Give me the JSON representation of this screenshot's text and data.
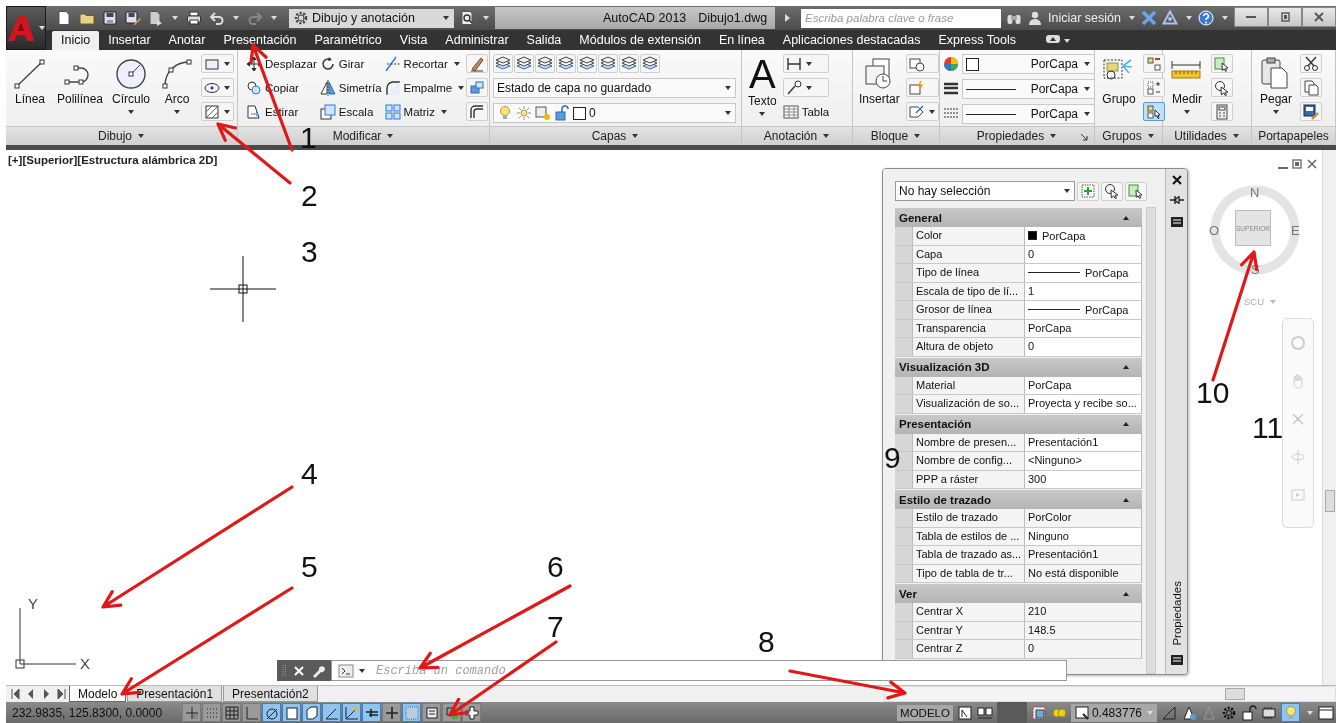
{
  "title_bar": {
    "workspace": "Dibujo y anotación",
    "app_title": "AutoCAD 2013",
    "file_name": "Dibujo1.dwg",
    "search_placeholder": "Escriba palabra clave o frase",
    "sign_in": "Iniciar sesión"
  },
  "ribbon_tabs": [
    {
      "label": "Inicio",
      "selected": true
    },
    {
      "label": "Insertar",
      "selected": false
    },
    {
      "label": "Anotar",
      "selected": false
    },
    {
      "label": "Presentación",
      "selected": false
    },
    {
      "label": "Paramétrico",
      "selected": false
    },
    {
      "label": "Vista",
      "selected": false
    },
    {
      "label": "Administrar",
      "selected": false
    },
    {
      "label": "Salida",
      "selected": false
    },
    {
      "label": "Módulos de extensión",
      "selected": false
    },
    {
      "label": "En línea",
      "selected": false
    },
    {
      "label": "Aplicaciones destacadas",
      "selected": false
    },
    {
      "label": "Express Tools",
      "selected": false
    }
  ],
  "ribbon_panels": [
    {
      "kind": "draw",
      "title": "Dibujo",
      "menu": true,
      "tools": [
        {
          "label": "Línea",
          "menu": false
        },
        {
          "label": "Polilínea",
          "menu": false
        },
        {
          "label": "Círculo",
          "menu": true
        },
        {
          "label": "Arco",
          "menu": true
        }
      ]
    },
    {
      "kind": "modify",
      "title": "Modificar",
      "menu": true,
      "tools": [
        {
          "label": "Desplazar",
          "menu": false
        },
        {
          "label": "Girar",
          "menu": false
        },
        {
          "label": "Recortar",
          "menu": true
        },
        {
          "label": "Copiar",
          "menu": false
        },
        {
          "label": "Simetría",
          "menu": false
        },
        {
          "label": "Empalme",
          "menu": true
        },
        {
          "label": "Estirar",
          "menu": false
        },
        {
          "label": "Escala",
          "menu": false
        },
        {
          "label": "Matriz",
          "menu": true
        }
      ]
    },
    {
      "kind": "layers",
      "title": "Capas",
      "menu": true,
      "layer_state": "Estado de capa no guardado",
      "layer": "0"
    },
    {
      "kind": "annotation",
      "title": "Anotación",
      "menu": true,
      "glyph": "A",
      "text_tool": "Texto",
      "table_tool": "Tabla"
    },
    {
      "kind": "block",
      "title": "Bloque",
      "menu": true,
      "tool": "Insertar"
    },
    {
      "kind": "properties",
      "title": "Propiedades",
      "menu": true,
      "color_value": "PorCapa",
      "lineweight": "PorCapa",
      "linetype": "PorCapa"
    },
    {
      "kind": "groups",
      "title": "Grupos",
      "menu": true,
      "tool": "Grupo"
    },
    {
      "kind": "utilities",
      "title": "Utilidades",
      "menu": true,
      "tool": "Medir"
    },
    {
      "kind": "clipboard",
      "title": "Portapapeles",
      "menu": false,
      "tool": "Pegar"
    }
  ],
  "viewport_label": "[+][Superior][Estructura alámbrica 2D]",
  "ucs": {
    "x": "X",
    "y": "Y"
  },
  "properties_palette": {
    "selection": "No hay selección",
    "side_title": "Propiedades",
    "sections": [
      {
        "title": "General",
        "expanded": true,
        "rows": [
          {
            "label": "Color",
            "value": "PorCapa",
            "kind": "swatch",
            "readonly": false
          },
          {
            "label": "Capa",
            "value": "0",
            "kind": "text",
            "readonly": false
          },
          {
            "label": "Tipo de línea",
            "value": "PorCapa",
            "kind": "line",
            "readonly": false
          },
          {
            "label": "Escala de tipo de lí...",
            "value": "1",
            "kind": "text",
            "readonly": false
          },
          {
            "label": "Grosor de línea",
            "value": "PorCapa",
            "kind": "line",
            "readonly": false
          },
          {
            "label": "Transparencia",
            "value": "PorCapa",
            "kind": "text",
            "readonly": false
          },
          {
            "label": "Altura de objeto",
            "value": "0",
            "kind": "text",
            "readonly": false
          }
        ]
      },
      {
        "title": "Visualización 3D",
        "expanded": true,
        "rows": [
          {
            "label": "Material",
            "value": "PorCapa",
            "kind": "text",
            "readonly": false
          },
          {
            "label": "Visualización de so...",
            "value": "Proyecta y recibe so...",
            "kind": "text",
            "readonly": false
          }
        ]
      },
      {
        "title": "Presentación",
        "expanded": true,
        "rows": [
          {
            "label": "Nombre de presen...",
            "value": "Presentación1",
            "kind": "text",
            "readonly": false
          },
          {
            "label": "Nombre de config...",
            "value": "<Ninguno>",
            "kind": "text",
            "readonly": false
          },
          {
            "label": "PPP a ráster",
            "value": "300",
            "kind": "text",
            "readonly": false
          }
        ]
      },
      {
        "title": "Estilo de trazado",
        "expanded": true,
        "rows": [
          {
            "label": "Estilo de trazado",
            "value": "PorColor",
            "kind": "text",
            "readonly": true
          },
          {
            "label": "Tabla de estilos de ...",
            "value": "Ninguno",
            "kind": "text",
            "readonly": false
          },
          {
            "label": "Tabla de trazado as...",
            "value": "Presentación1",
            "kind": "text",
            "readonly": true
          },
          {
            "label": "Tipo de tabla de tr...",
            "value": "No está disponible",
            "kind": "text",
            "readonly": true
          }
        ]
      },
      {
        "title": "Ver",
        "expanded": true,
        "rows": [
          {
            "label": "Centrar X",
            "value": "210",
            "kind": "text",
            "readonly": true
          },
          {
            "label": "Centrar Y",
            "value": "148.5",
            "kind": "text",
            "readonly": true
          },
          {
            "label": "Centrar Z",
            "value": "0",
            "kind": "text",
            "readonly": true
          }
        ]
      }
    ]
  },
  "view_cube": {
    "north": "N",
    "south": "S",
    "east": "E",
    "west": "O",
    "face": "SUPERIOR",
    "ucs": "SCU"
  },
  "command_line": {
    "placeholder": "Escriba un comando"
  },
  "layout_tabs": [
    {
      "label": "Modelo",
      "selected": true
    },
    {
      "label": "Presentación1",
      "selected": false
    },
    {
      "label": "Presentación2",
      "selected": false
    }
  ],
  "status_bar": {
    "coordinates": "232.9835, 125.8300, 0.0000",
    "toggles": [
      {
        "on": false
      },
      {
        "on": false
      },
      {
        "on": false
      },
      {
        "on": false
      },
      {
        "on": true
      },
      {
        "on": true
      },
      {
        "on": true
      },
      {
        "on": true
      },
      {
        "on": true
      },
      {
        "on": true
      },
      {
        "on": false
      },
      {
        "on": true
      },
      {
        "on": false
      },
      {
        "on": false
      },
      {
        "on": false
      }
    ],
    "space": "MODELO",
    "annotation_scale": "0.483776"
  },
  "callouts": [
    {
      "label": "1",
      "arrow": true
    },
    {
      "label": "2",
      "arrow": true
    },
    {
      "label": "3",
      "arrow": false
    },
    {
      "label": "4",
      "arrow": true
    },
    {
      "label": "5",
      "arrow": true
    },
    {
      "label": "6",
      "arrow": true
    },
    {
      "label": "7",
      "arrow": true
    },
    {
      "label": "8",
      "arrow": true
    },
    {
      "label": "9",
      "arrow": false
    },
    {
      "label": "10",
      "arrow": true
    },
    {
      "label": "11",
      "arrow": false
    }
  ]
}
